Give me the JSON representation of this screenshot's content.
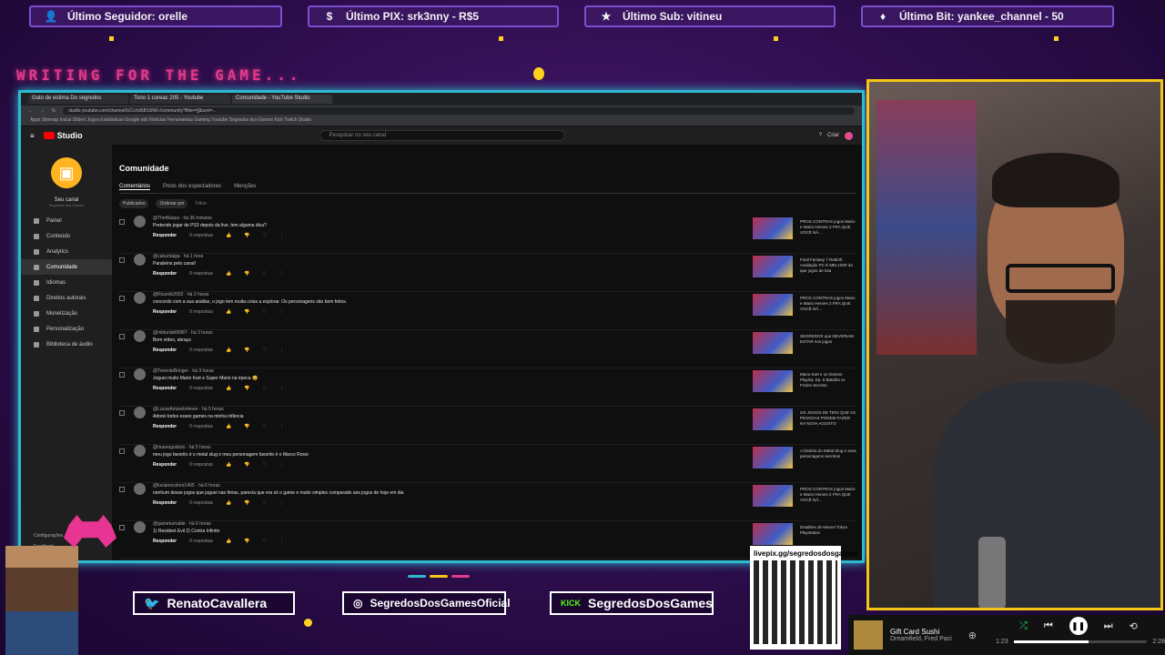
{
  "overlay": {
    "top_bars": [
      {
        "icon": "user-icon",
        "label": "Último Seguidor: orelle"
      },
      {
        "icon": "pix-icon",
        "label": "Último PIX: srk3nny - R$5"
      },
      {
        "icon": "star-icon",
        "label": "Último Sub: vitineu"
      },
      {
        "icon": "bits-icon",
        "label": "Último Bit: yankee_channel - 50"
      }
    ],
    "waiting_text": "WRITING FOR THE GAME...",
    "socials": [
      {
        "icon": "twitter-icon",
        "label": "RenatoCavallera"
      },
      {
        "icon": "instagram-icon",
        "label": "SegredosDosGamesOficial"
      },
      {
        "icon": "kick-icon",
        "label": "SegredosDosGames"
      }
    ],
    "qr_label": "livepix.gg/segredosdosgames",
    "accent": "#2fb9d1",
    "cam_border": "#f5c518"
  },
  "browser": {
    "tabs": [
      "Gato de estima Do segredos",
      "Tono 1 coreac 205 - Youtube",
      "Comunidade - YouTube Studio"
    ],
    "url": "studio.youtube.com/channel/UCvXd5B10iN0-/community?filter=[]&sort=...",
    "bookmarks": "Apps  Sitemap  Inicial  Dilbert  Jogos  Estatísticas  Google ads  Notícias  Ferramentas  Gaming  Youtube  Segredos dos Games  Kick  Twitch  Studio"
  },
  "studio": {
    "logo": "Studio",
    "search_placeholder": "Pesquisar no seu canal",
    "create_label": "Criar",
    "channel_name": "Seu canal",
    "channel_sub": "Segredos dos Games",
    "nav": [
      "Painel",
      "Conteúdo",
      "Analytics",
      "Comunidade",
      "Idiomas",
      "Direitos autorais",
      "Monetização",
      "Personalização",
      "Biblioteca de áudio"
    ],
    "settings_label": "Configurações",
    "feedback_label": "Feedback",
    "page_title": "Comunidade",
    "subtabs": [
      "Comentários",
      "Posts dos espectadores",
      "Menções"
    ],
    "filter_published": "Publicados",
    "filter_sort": "Ordenar por",
    "filter_search": "Filtrar",
    "reply_label": "Responder",
    "replies_label": "0 respostas",
    "comments": [
      {
        "author": "@TheWaqos · há 36 minutos",
        "text": "Pretendo jogar de PS3 depois da live, tem alguma dica?",
        "video": "PROS CONTRAS jogos Mario e Mario Heroes 2 FRA QUE VOCÊ NÃ..."
      },
      {
        "author": "@cabuntaiga · há 1 hora",
        "text": "Parabéns pelo canal!",
        "video": "Final Fantasy 7 Rebirth Avaliação PC É MELHOR do que jogos de luta"
      },
      {
        "author": "@Ricardo2002 · há 2 horas",
        "text": "concordo com a sua análise, o jogo tem muita coisa a explorar. Os personagens são bem feitos.",
        "video": "PROS CONTRAS jogos Mario e Mario Heroes 2 FRA QUE VOCÊ NÃ..."
      },
      {
        "author": "@mblundell0987 · há 3 horas",
        "text": "Bom vídeo, abraço",
        "video": "SEGREDOS que DEVERIAM ESTAR nos jogos"
      },
      {
        "author": "@TooenteBringer · há 3 horas",
        "text": "Joguei muito Mario Kart e Super Mario na época 😄",
        "video": "Mario Kart e os Games Playlist, Ep. 5 Batalha vs Frame Secreto"
      },
      {
        "author": "@LucasAmarelo4ever · há 5 horas",
        "text": "Adorei todos esses games na minha infância",
        "video": "OS JOGOS DE TIRO QUE AS PESSOAS PODEM FAZER NA NOVA AGOSTO"
      },
      {
        "author": "@mauroguiduio · há 5 horas",
        "text": "meu jogo favorito é o metal slug e meu personagem favorito é o Marco Rossi",
        "video": "A história do Metal Slug e seus personagens secretos"
      },
      {
        "author": "@lucianocolore1405 · há 6 horas",
        "text": "nenhum desse jogos que joguei nas férias, parecia que era só o game e muito simples comparado aos jogos de hoje em dia",
        "video": "PROS CONTRAS jogos Mario e Mario Heroes 2 FRA QUE VOCÊ NÃ..."
      },
      {
        "author": "@gameturnalde · há 6 horas",
        "text": "1) Resident Evil 2) Contra Infinito",
        "video": "Detalhes de Marvel Tokon Playstation"
      }
    ]
  },
  "spotify": {
    "track": "Gift Card Sushi",
    "artist": "Dreamfield, Fred Paci",
    "elapsed": "1:23",
    "duration": "2:28",
    "progress": 0.56
  }
}
